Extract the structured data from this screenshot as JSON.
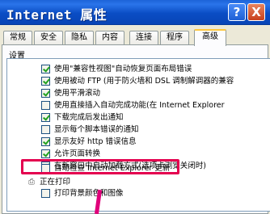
{
  "window": {
    "title": "Internet 属性",
    "help_label": "?",
    "close_label": "X"
  },
  "tabs": [
    {
      "label": "常规",
      "active": false
    },
    {
      "label": "安全",
      "active": false
    },
    {
      "label": "隐私",
      "active": false
    },
    {
      "label": "内容",
      "active": false
    },
    {
      "label": "连接",
      "active": false
    },
    {
      "label": "程序",
      "active": false
    },
    {
      "label": "高级",
      "active": true
    }
  ],
  "settings": {
    "group_label": "设置",
    "items": [
      {
        "label": "使用\"兼容性视图\"自动恢复页面布局错误",
        "checked": true
      },
      {
        "label": "使用被动 FTP (用于防火墙和 DSL 调制解调器的兼容",
        "checked": true
      },
      {
        "label": "使用平滑滚动",
        "checked": true
      },
      {
        "label": "使用直接插入自动完成功能(在 Internet Explorer",
        "checked": false
      },
      {
        "label": "下载完成后发出通知",
        "checked": true
      },
      {
        "label": "显示每个脚本错误的通知",
        "checked": false
      },
      {
        "label": "显示友好 http 错误信息",
        "checked": true
      },
      {
        "label": "允许页面转换",
        "checked": true
      },
      {
        "label": "在新窗口中自动加载方式(选项卡浏览关闭时)",
        "checked": true
      },
      {
        "label": "自动检查 Internet Explorer 更新",
        "checked": false
      }
    ],
    "section_label": "正在打印",
    "section_item": {
      "label": "打印背景颜色和图像",
      "checked": false
    }
  },
  "colors": {
    "highlight": "#e4004f",
    "title_bar": "#0a4dc4"
  }
}
